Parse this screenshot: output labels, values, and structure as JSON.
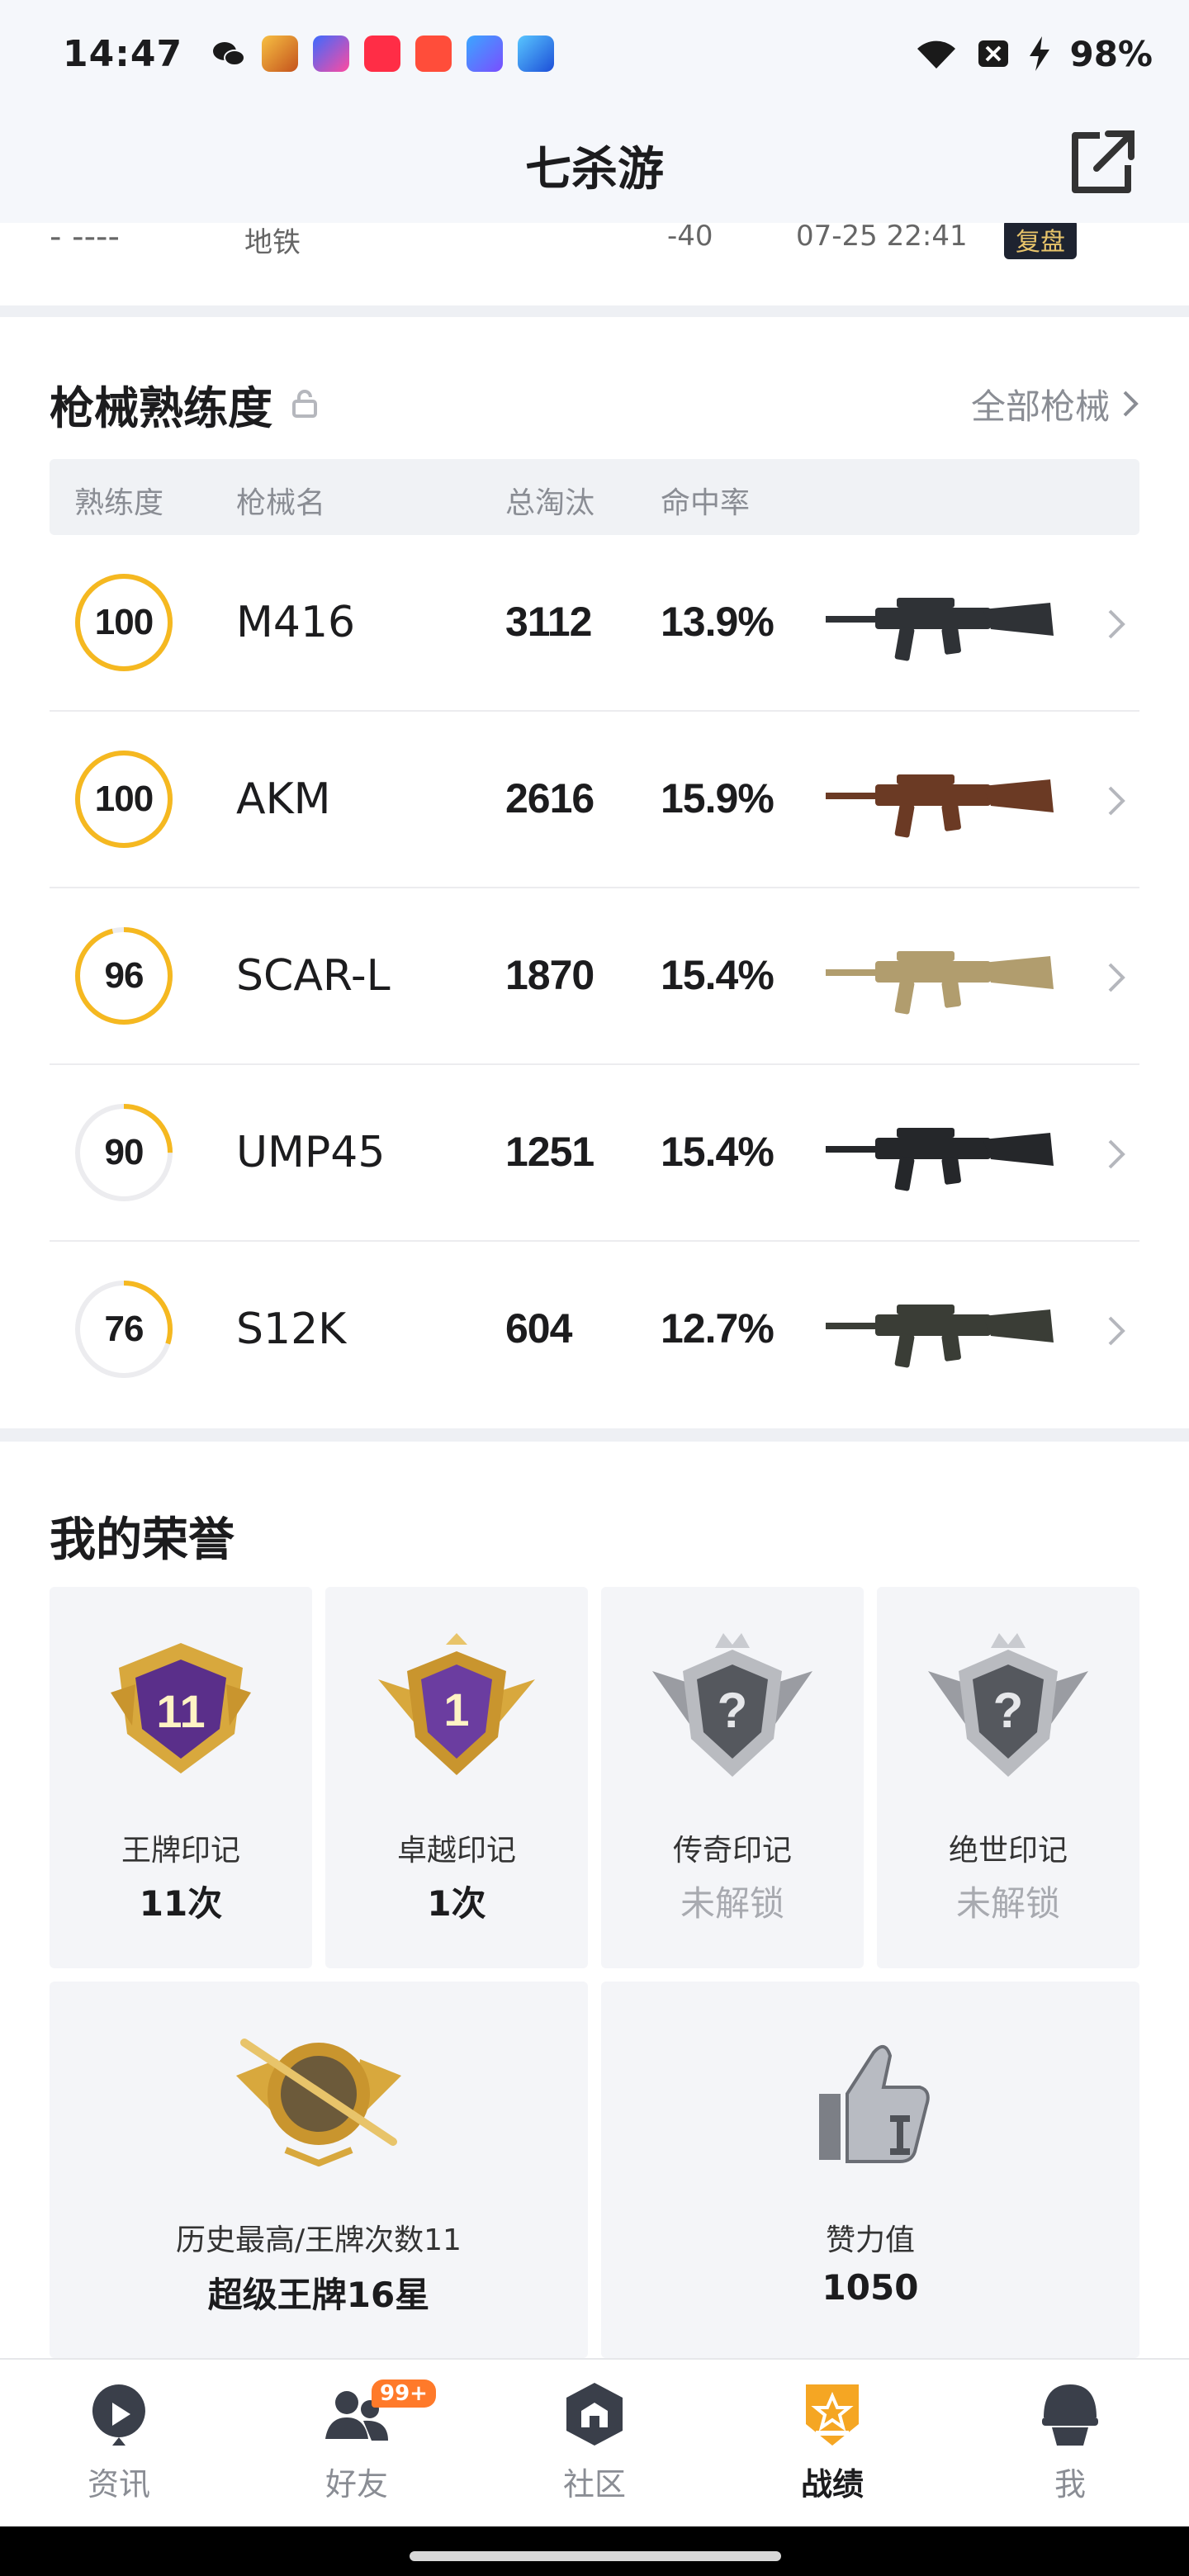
{
  "status_bar": {
    "time": "14:47",
    "battery": "98%",
    "icons": [
      "wechat-icon",
      "app-icon-1",
      "app-icon-2",
      "music-icon",
      "video-icon",
      "game-icon-1",
      "game-icon-2",
      "wifi-icon",
      "sim-off-icon",
      "charging-icon"
    ]
  },
  "header": {
    "title": "七杀游"
  },
  "partial_row": {
    "map": "地铁",
    "score": "-40",
    "time": "07-25 22:41",
    "tag": "复盘"
  },
  "weapons": {
    "title": "枪械熟练度",
    "all_link": "全部枪械",
    "columns": {
      "mastery": "熟练度",
      "name": "枪械名",
      "kills": "总淘汰",
      "accuracy": "命中率"
    },
    "rows": [
      {
        "mastery": "100",
        "mastery_pct": 1.0,
        "name": "M416",
        "kills": "3112",
        "accuracy": "13.9%",
        "gun_color": "#2f3236"
      },
      {
        "mastery": "100",
        "mastery_pct": 1.0,
        "name": "AKM",
        "kills": "2616",
        "accuracy": "15.9%",
        "gun_color": "#6b3a24"
      },
      {
        "mastery": "96",
        "mastery_pct": 0.96,
        "name": "SCAR-L",
        "kills": "1870",
        "accuracy": "15.4%",
        "gun_color": "#b19d6e"
      },
      {
        "mastery": "90",
        "mastery_pct": 0.25,
        "name": "UMP45",
        "kills": "1251",
        "accuracy": "15.4%",
        "gun_color": "#25272a"
      },
      {
        "mastery": "76",
        "mastery_pct": 0.3,
        "name": "S12K",
        "kills": "604",
        "accuracy": "12.7%",
        "gun_color": "#3a3d36"
      }
    ]
  },
  "honors": {
    "title": "我的荣誉",
    "cards": [
      {
        "name": "王牌印记",
        "value": "11次",
        "locked": false,
        "emblem_text": "11"
      },
      {
        "name": "卓越印记",
        "value": "1次",
        "locked": false,
        "emblem_text": "1"
      },
      {
        "name": "传奇印记",
        "value": "未解锁",
        "locked": true,
        "emblem_text": "?"
      },
      {
        "name": "绝世印记",
        "value": "未解锁",
        "locked": true,
        "emblem_text": "?"
      }
    ],
    "wide_cards": [
      {
        "name": "历史最高/王牌次数11",
        "value": "超级王牌16星"
      },
      {
        "name": "赞力值",
        "value": "1050"
      }
    ]
  },
  "nav": {
    "items": [
      {
        "label": "资讯",
        "icon": "news-icon"
      },
      {
        "label": "好友",
        "icon": "friends-icon",
        "badge": "99+"
      },
      {
        "label": "社区",
        "icon": "community-icon"
      },
      {
        "label": "战绩",
        "icon": "record-icon",
        "active": true
      },
      {
        "label": "我",
        "icon": "profile-icon"
      }
    ]
  },
  "colors": {
    "gold": "#f5b820",
    "ring_track": "#ececef",
    "accent_orange": "#ff7a2a"
  }
}
